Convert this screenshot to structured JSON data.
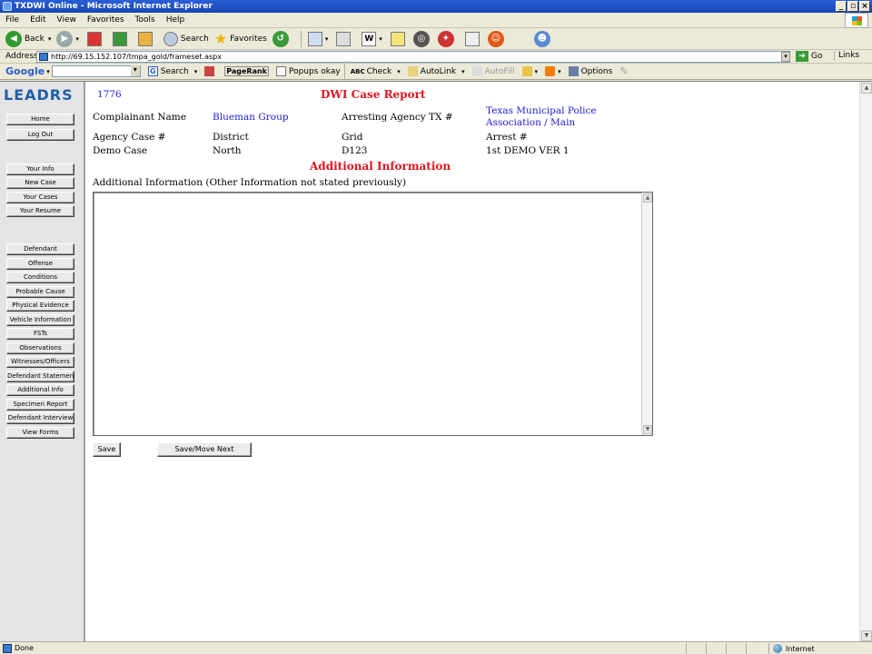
{
  "window": {
    "title": "TXDWI Online - Microsoft Internet Explorer"
  },
  "menu": [
    "File",
    "Edit",
    "View",
    "Favorites",
    "Tools",
    "Help"
  ],
  "toolbar": {
    "back_label": "Back",
    "search_label": "Search",
    "favorites_label": "Favorites"
  },
  "address": {
    "label": "Address",
    "url": "http://69.15.152.107/tmpa_gold/frameset.aspx",
    "go_label": "Go",
    "links_label": "Links"
  },
  "google_bar": {
    "logo": "Google",
    "search_label": "Search",
    "pagerank_label": "PageRank",
    "popups_label": "Popups okay",
    "check_label": "Check",
    "autolink_label": "AutoLink",
    "autofill_label": "AutoFill",
    "options_label": "Options"
  },
  "sidebar": {
    "logo": "LEADRS",
    "top_buttons": [
      "Home",
      "Log Out"
    ],
    "user_buttons": [
      "Your Info",
      "New Case",
      "Your Cases",
      "Your Resume"
    ],
    "case_buttons": [
      "Defendant",
      "Offense",
      "Conditions",
      "Probable Cause",
      "Physical Evidence",
      "Vehicle Information",
      "FSTs",
      "Observations",
      "Witnesses/Officers",
      "Defendant Statement",
      "Additional Info",
      "Specimen Report",
      "Defendant Interview",
      "View Forms"
    ]
  },
  "report": {
    "case_id": "1776",
    "title": "DWI Case Report",
    "complainant_label": "Complainant Name",
    "complainant_value": "Blueman Group",
    "arresting_agency_label": "Arresting Agency TX #",
    "arresting_agency_value_line1": "Texas Municipal Police",
    "arresting_agency_value_line2": "Association / Main",
    "agency_case_label": "Agency Case #",
    "district_label": "District",
    "grid_label": "Grid",
    "arrest_label": "Arrest #",
    "agency_case_value": "Demo Case",
    "district_value": "North",
    "grid_value": "D123",
    "arrest_value": "1st DEMO VER 1",
    "section_title": "Additional Information",
    "field_label": "Additional Information (Other Information not stated previously)",
    "field_value": "",
    "save_label": "Save",
    "save_next_label": "Save/Move Next"
  },
  "status": {
    "text": "Done",
    "zone": "Internet"
  }
}
